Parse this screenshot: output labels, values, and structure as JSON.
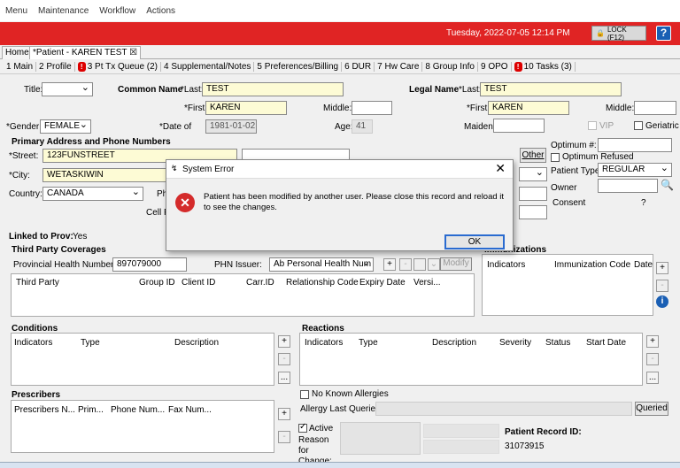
{
  "menu": [
    "Menu",
    "Maintenance",
    "Workflow",
    "Actions"
  ],
  "header": {
    "datetime": "Tuesday, 2022-07-05 12:14 PM",
    "lock_label": "LOCK (F12)",
    "help": "?"
  },
  "doc_tabs": [
    "Home",
    "*Patient - KAREN TEST"
  ],
  "sub_tabs": [
    {
      "label": "1 Main"
    },
    {
      "label": "2 Profile"
    },
    {
      "label": "3 Pt Tx Queue (2)",
      "warn": true
    },
    {
      "label": "4 Supplemental/Notes"
    },
    {
      "label": "5 Preferences/Billing"
    },
    {
      "label": "6 DUR"
    },
    {
      "label": "7 Hw Care"
    },
    {
      "label": "8 Group Info"
    },
    {
      "label": "9 OPO"
    },
    {
      "label": "10 Tasks (3)",
      "warn": true
    }
  ],
  "common_name": {
    "section": "Common Name",
    "last_label": "*Last:",
    "last": "TEST",
    "first_label": "*First:",
    "first": "KAREN",
    "middle_label": "Middle:",
    "middle": ""
  },
  "legal_name": {
    "section": "Legal Name",
    "last_label": "*Last:",
    "last": "TEST",
    "first_label": "*First:",
    "first": "KAREN",
    "middle_label": "Middle:",
    "middle": "",
    "maiden_label": "Maiden:",
    "maiden": "",
    "vip": "VIP",
    "geriatric": "Geriatric"
  },
  "title_label": "Title:",
  "gender": {
    "label": "*Gender:",
    "value": "FEMALE"
  },
  "dob": {
    "label": "*Date of",
    "value": "1981-01-02"
  },
  "age": {
    "label": "Age:",
    "value": "41"
  },
  "address": {
    "section": "Primary Address and Phone Numbers",
    "street_label": "*Street:",
    "street": "123FUNSTREET",
    "city_label": "*City:",
    "city": "WETASKIWIN",
    "country_label": "Country:",
    "country": "CANADA",
    "ph_label": "Ph",
    "cell_label": "Cell P",
    "other_btn": "Other"
  },
  "optimum": {
    "label": "Optimum #:",
    "refused": "Optimum Refused"
  },
  "patient_type": {
    "label": "Patient Type",
    "value": "REGULAR"
  },
  "owner_label": "Owner",
  "consent": {
    "label": "Consent",
    "value": "?"
  },
  "linked": {
    "label": "Linked to Prov:",
    "value": "Yes"
  },
  "third_party": {
    "section": "Third Party Coverages",
    "phn_label": "Provincial Health Number:",
    "phn": "897079000",
    "issuer_label": "PHN Issuer:",
    "issuer": "Ab Personal Health Num",
    "modify": "Modify",
    "columns": [
      "Third Party",
      "Group ID",
      "Client ID",
      "Carr.ID",
      "Relationship Code",
      "Expiry Date",
      "Versi..."
    ]
  },
  "immunizations": {
    "section": "Immunizations",
    "columns": [
      "Indicators",
      "Immunization Code",
      "Date"
    ]
  },
  "conditions": {
    "section": "Conditions",
    "columns": [
      "Indicators",
      "Type",
      "Description"
    ]
  },
  "reactions": {
    "section": "Reactions",
    "columns": [
      "Indicators",
      "Type",
      "Description",
      "Severity",
      "Status",
      "Start Date"
    ],
    "no_known": "No Known Allergies",
    "last_queried_label": "Allergy Last Queried:",
    "queried_btn": "Queried"
  },
  "prescribers": {
    "section": "Prescribers",
    "columns": [
      "Prescribers N...",
      "Prim...",
      "Phone Num...",
      "Fax Num..."
    ]
  },
  "active": {
    "label": "Active",
    "reason_label": "Reason for Change:"
  },
  "record": {
    "label": "Patient Record ID:",
    "value": "31073915"
  },
  "dialog": {
    "title": "System Error",
    "message": "Patient has been modified by another user. Please close this record and reload it to see the changes.",
    "ok": "OK"
  }
}
